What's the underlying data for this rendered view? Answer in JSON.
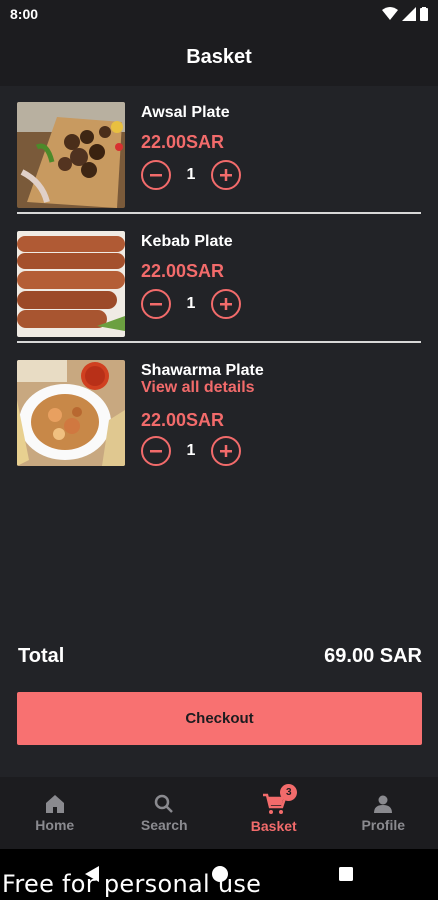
{
  "status_bar": {
    "time": "8:00"
  },
  "header": {
    "title": "Basket"
  },
  "items": [
    {
      "name": "Awsal Plate",
      "details_link": "",
      "price": "22.00SAR",
      "quantity": "1"
    },
    {
      "name": "Kebab Plate",
      "details_link": "",
      "price": "22.00SAR",
      "quantity": "1"
    },
    {
      "name": "Shawarma Plate",
      "details_link": "View all details",
      "price": "22.00SAR",
      "quantity": "1"
    }
  ],
  "total": {
    "label": "Total",
    "value": "69.00 SAR"
  },
  "checkout": {
    "label": "Checkout"
  },
  "bottom_nav": {
    "items": [
      {
        "label": "Home",
        "icon": "home-icon"
      },
      {
        "label": "Search",
        "icon": "search-icon"
      },
      {
        "label": "Basket",
        "icon": "cart-icon",
        "badge": "3",
        "active": true
      },
      {
        "label": "Profile",
        "icon": "person-icon"
      }
    ]
  },
  "watermark": "Free for personal use",
  "colors": {
    "accent": "#f26b6b",
    "button": "#f87171",
    "background": "#222327",
    "bar": "#1c1c1f"
  }
}
